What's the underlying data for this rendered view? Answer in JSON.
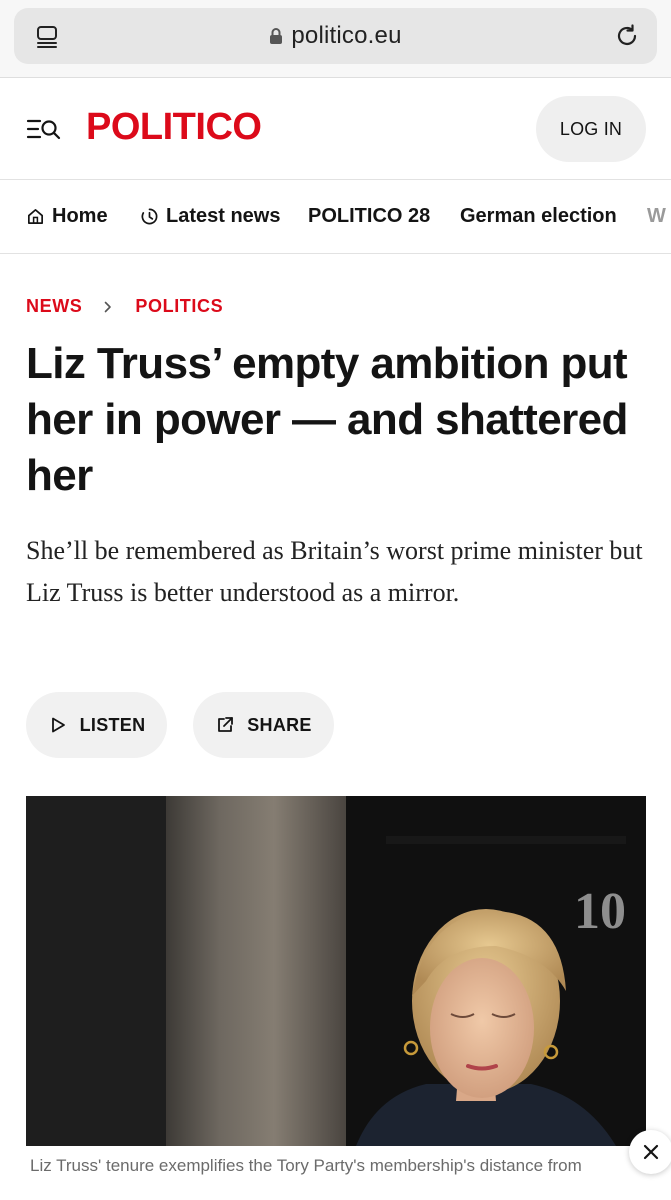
{
  "browser": {
    "url": "politico.eu",
    "icons": {
      "tabs": "tabs-icon",
      "lock": "lock-icon",
      "reload": "reload-icon"
    }
  },
  "header": {
    "logo": "POLITICO",
    "login_label": "LOG IN",
    "brand_color": "#dc0a1a",
    "icons": {
      "menu": "menu-search-icon"
    }
  },
  "nav": {
    "items": [
      {
        "label": "Home",
        "icon": "home-icon"
      },
      {
        "label": "Latest news",
        "icon": "clock-icon"
      },
      {
        "label": "POLITICO 28"
      },
      {
        "label": "German election"
      },
      {
        "label": "W"
      }
    ]
  },
  "article": {
    "breadcrumb": [
      "NEWS",
      "POLITICS"
    ],
    "headline": "Liz Truss’ empty ambition put her in power — and shattered her",
    "dek": "She’ll be remembered as Britain’s worst prime minister but Liz Truss is better understood as a mirror.",
    "actions": {
      "listen_label": "LISTEN",
      "share_label": "SHARE"
    },
    "photo": {
      "door_number": "10"
    },
    "caption": "Liz Truss' tenure exemplifies the Tory Party's membership's distance from"
  },
  "overlay": {
    "close_icon": "close-icon"
  }
}
